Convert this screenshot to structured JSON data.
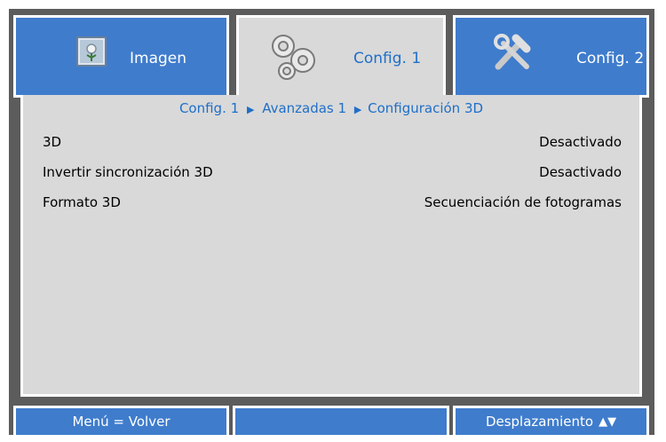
{
  "colors": {
    "accent_blue": "#3f7ccc",
    "panel_gray": "#d9d9d9",
    "frame_gray": "#5c5c5c",
    "active_text": "#1f6fc8"
  },
  "tabs": [
    {
      "label": "Imagen",
      "icon": "image-icon",
      "active": false
    },
    {
      "label": "Config. 1",
      "icon": "gears-icon",
      "active": true
    },
    {
      "label": "Config. 2",
      "icon": "tools-icon",
      "active": false
    }
  ],
  "breadcrumb": {
    "part1": "Config. 1",
    "part2": "Avanzadas 1",
    "part3": "Configuración 3D"
  },
  "settings": [
    {
      "label": "3D",
      "value": "Desactivado"
    },
    {
      "label": "Invertir sincronización 3D",
      "value": "Desactivado"
    },
    {
      "label": "Formato 3D",
      "value": "Secuenciación de fotogramas"
    }
  ],
  "footer": {
    "left": "Menú = Volver",
    "middle": "",
    "right": "Desplazamiento"
  }
}
